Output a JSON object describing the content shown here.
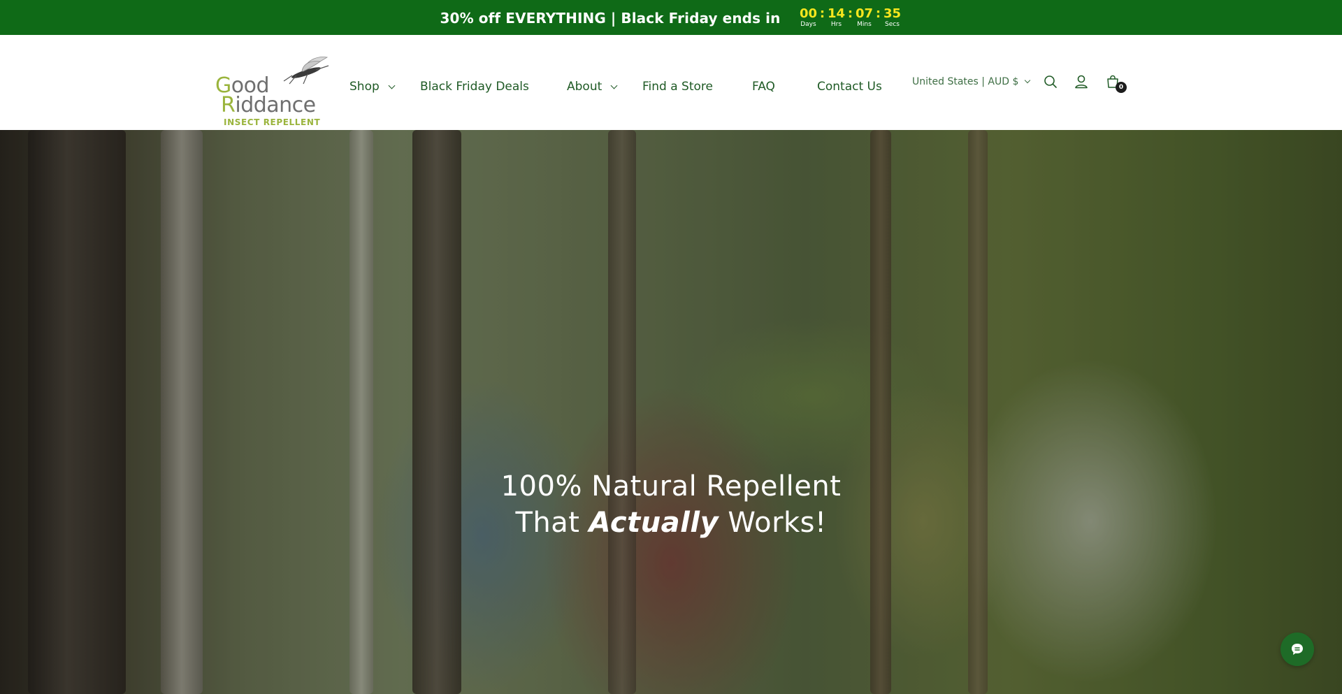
{
  "announcement": {
    "text": "30% off EVERYTHING | Black Friday ends in",
    "countdown": [
      {
        "value": "00",
        "label": "Days"
      },
      {
        "value": "14",
        "label": "Hrs"
      },
      {
        "value": "07",
        "label": "Mins"
      },
      {
        "value": "35",
        "label": "Secs"
      }
    ],
    "separator": ":",
    "bg_color": "#0f6a17",
    "number_color": "#f6e61e"
  },
  "logo": {
    "line1_prefix": "G",
    "line1_rest": "ood",
    "line2_prefix": "R",
    "line2_rest": "iddance",
    "tagline": "INSECT REPELLENT"
  },
  "nav": {
    "items": [
      {
        "label": "Shop",
        "has_dropdown": true
      },
      {
        "label": "Black Friday Deals",
        "has_dropdown": false
      },
      {
        "label": "About",
        "has_dropdown": true
      },
      {
        "label": "Find a Store",
        "has_dropdown": false
      },
      {
        "label": "FAQ",
        "has_dropdown": false
      },
      {
        "label": "Contact Us",
        "has_dropdown": false
      }
    ],
    "locale": "United States | AUD $",
    "cart_count": "0",
    "text_color": "#1f5a25"
  },
  "hero": {
    "line1": "100% Natural Repellent",
    "line2_before": "That ",
    "line2_emphasis": "Actually",
    "line2_after": " Works!"
  },
  "icons": [
    "search-icon",
    "account-icon",
    "cart-icon",
    "chevron-down-icon",
    "chat-icon",
    "mosquito-logo-icon"
  ]
}
